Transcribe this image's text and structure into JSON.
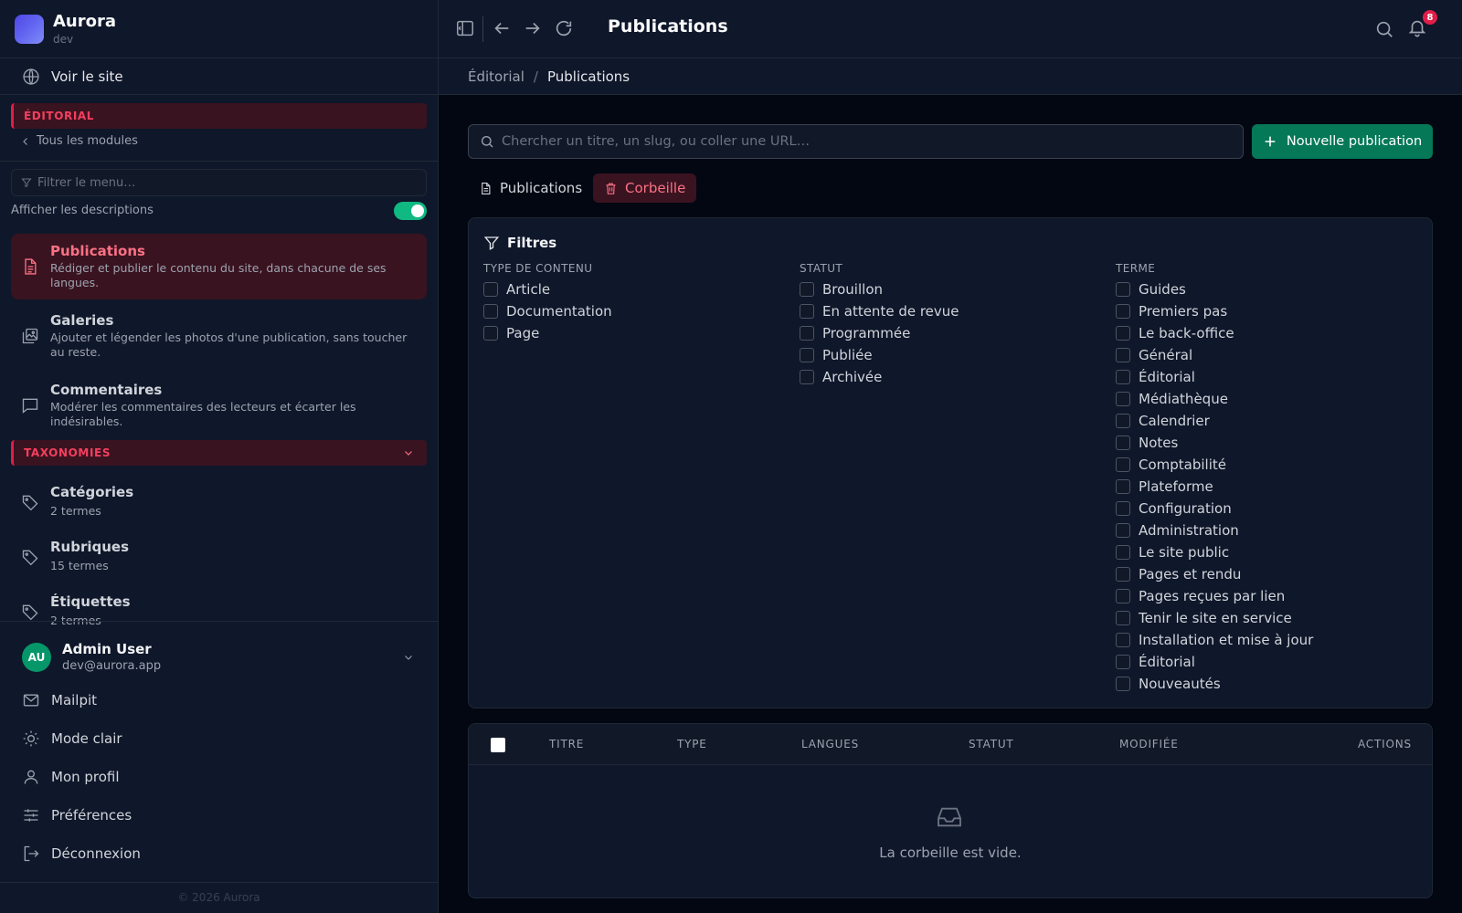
{
  "brand": {
    "name": "Aurora",
    "env": "dev"
  },
  "sidebar": {
    "view_site": "Voir le site",
    "section_editorial": "ÉDITORIAL",
    "back_link": "Tous les modules",
    "filter_placeholder": "Filtrer le menu…",
    "show_descriptions": "Afficher les descriptions",
    "show_descriptions_on": true,
    "items": [
      {
        "title": "Publications",
        "desc": "Rédiger et publier le contenu du site, dans chacune de ses langues.",
        "active": true
      },
      {
        "title": "Galeries",
        "desc": "Ajouter et légender les photos d'une publication, sans toucher au reste.",
        "active": false
      },
      {
        "title": "Commentaires",
        "desc": "Modérer les commentaires des lecteurs et écarter les indésirables.",
        "active": false
      }
    ],
    "section_taxonomies": "TAXONOMIES",
    "taxonomies": [
      {
        "title": "Catégories",
        "sub": "2 termes"
      },
      {
        "title": "Rubriques",
        "sub": "15 termes"
      },
      {
        "title": "Étiquettes",
        "sub": "2 termes"
      }
    ],
    "user": {
      "initials": "AU",
      "name": "Admin User",
      "email": "dev@aurora.app"
    },
    "bottom": [
      {
        "label": "Mailpit",
        "icon": "mail-icon"
      },
      {
        "label": "Mode clair",
        "icon": "sun-icon"
      },
      {
        "label": "Mon profil",
        "icon": "user-icon"
      },
      {
        "label": "Préférences",
        "icon": "sliders-icon"
      },
      {
        "label": "Déconnexion",
        "icon": "logout-icon"
      }
    ],
    "copyright": "© 2026 Aurora"
  },
  "topbar": {
    "title": "Publications",
    "notifications": "8"
  },
  "breadcrumb": {
    "parent": "Éditorial",
    "separator": "/",
    "current": "Publications"
  },
  "main": {
    "search_placeholder": "Chercher un titre, un slug, ou coller une URL…",
    "new_button": "Nouvelle publication",
    "tabs": [
      {
        "label": "Publications",
        "active": false
      },
      {
        "label": "Corbeille",
        "active": true
      }
    ],
    "filters": {
      "title": "Filtres",
      "content_type": {
        "header": "TYPE DE CONTENU",
        "options": [
          "Article",
          "Documentation",
          "Page"
        ]
      },
      "status": {
        "header": "STATUT",
        "options": [
          "Brouillon",
          "En attente de revue",
          "Programmée",
          "Publiée",
          "Archivée"
        ]
      },
      "term": {
        "header": "TERME",
        "options": [
          "Guides",
          "Premiers pas",
          "Le back-office",
          "Général",
          "Éditorial",
          "Médiathèque",
          "Calendrier",
          "Notes",
          "Comptabilité",
          "Plateforme",
          "Configuration",
          "Administration",
          "Le site public",
          "Pages et rendu",
          "Pages reçues par lien",
          "Tenir le site en service",
          "Installation et mise à jour",
          "Éditorial",
          "Nouveautés"
        ]
      }
    },
    "table": {
      "columns": [
        "TITRE",
        "TYPE",
        "LANGUES",
        "STATUT",
        "MODIFIÉE",
        "ACTIONS"
      ],
      "empty": "La corbeille est vide."
    }
  },
  "colors": {
    "accent": "#e11d48",
    "primary_button": "#047857",
    "toggle_on": "#10b981",
    "background": "#030712",
    "panel": "#0f172a"
  }
}
